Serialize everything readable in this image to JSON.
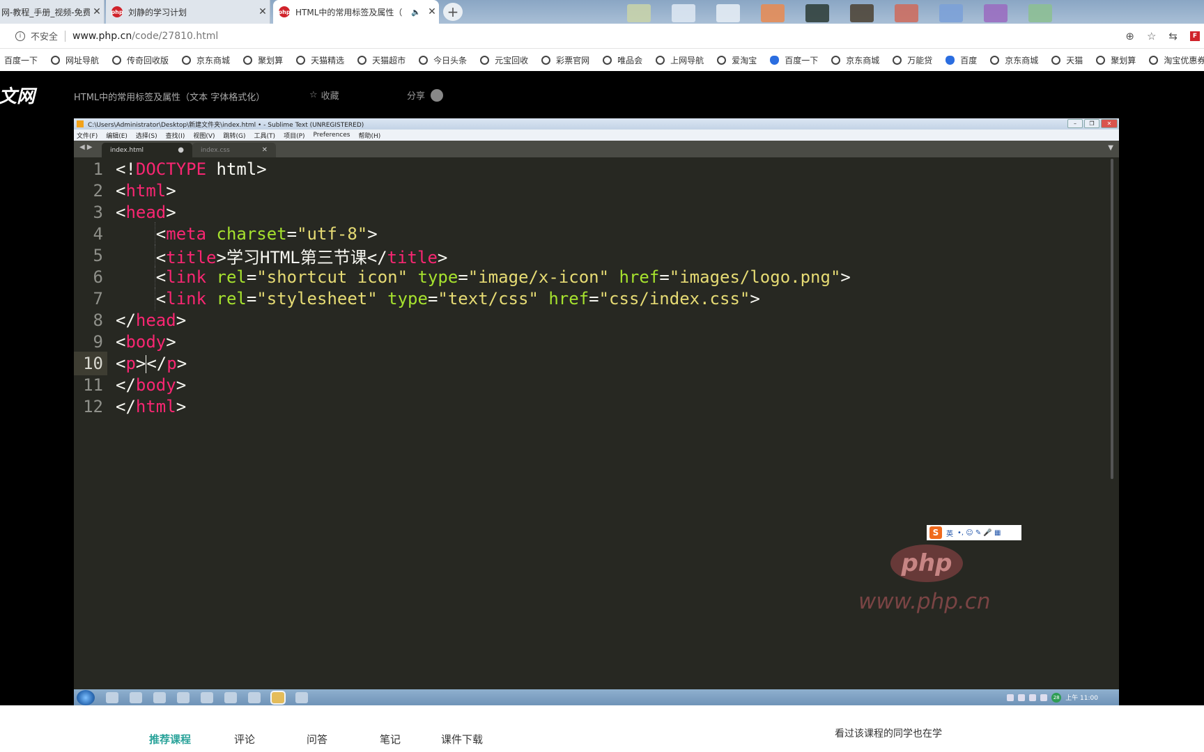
{
  "browser": {
    "tabs": [
      {
        "label": "网-教程_手册_视频-免费",
        "close": "✕"
      },
      {
        "label": "刘静的学习计划",
        "close": "✕"
      },
      {
        "label": "HTML中的常用标签及属性（",
        "close": "✕",
        "audio": "🔈"
      }
    ],
    "new_tab": "+",
    "address": {
      "security": "不安全",
      "host": "www.php.cn",
      "path": "/code/27810.html"
    },
    "toolbar_icons": {
      "zoom": "⊕",
      "star": "☆",
      "sync": "⇆",
      "ext": "F"
    },
    "bookmarks": [
      "百度一下",
      "网址导航",
      "传奇回收版",
      "京东商城",
      "聚划算",
      "天猫精选",
      "天猫超市",
      "今日头条",
      "元宝回收",
      "彩票官网",
      "唯品会",
      "上网导航",
      "爱淘宝",
      "百度一下",
      "京东商城",
      "万能贷",
      "百度",
      "京东商城",
      "天猫",
      "聚划算",
      "淘宝优惠券"
    ]
  },
  "site": {
    "logo": "文网",
    "course_title": "HTML中的常用标签及属性（文本 字体格式化）",
    "favorite": "收藏",
    "favorite_icon": "☆",
    "share": "分享"
  },
  "sublime": {
    "title": "C:\\Users\\Administrator\\Desktop\\新建文件夹\\index.html • - Sublime Text (UNREGISTERED)",
    "menu": [
      "文件(F)",
      "编辑(E)",
      "选择(S)",
      "查找(I)",
      "视图(V)",
      "跳转(G)",
      "工具(T)",
      "项目(P)",
      "Preferences",
      "帮助(H)"
    ],
    "tabs": [
      {
        "label": "index.html",
        "marker": "●"
      },
      {
        "label": "index.css",
        "marker": "✕"
      }
    ],
    "tab_arrows": "◀ ▶",
    "tab_more": "▼",
    "line_numbers": [
      "1",
      "2",
      "3",
      "4",
      "5",
      "6",
      "7",
      "8",
      "9",
      "10",
      "11",
      "12"
    ],
    "current_line": 10,
    "title_chars": "学习HTML第三节课"
  },
  "ime": {
    "lang": "英",
    "icons": "•, ☺ ✎ 🎤 ▦"
  },
  "watermark": {
    "logo": "php",
    "url": "www.php.cn"
  },
  "taskbar": {
    "time": "上午 11:00",
    "badge": "28"
  },
  "page_tabs": [
    "推荐课程",
    "评论",
    "问答",
    "笔记",
    "课件下载"
  ],
  "side_heading": "看过该课程的同学也在学",
  "colors": {
    "tag": "#f92672",
    "attr": "#a6e22e",
    "string": "#e6db74",
    "editor_bg": "#272822",
    "accent": "#2aa39a"
  }
}
